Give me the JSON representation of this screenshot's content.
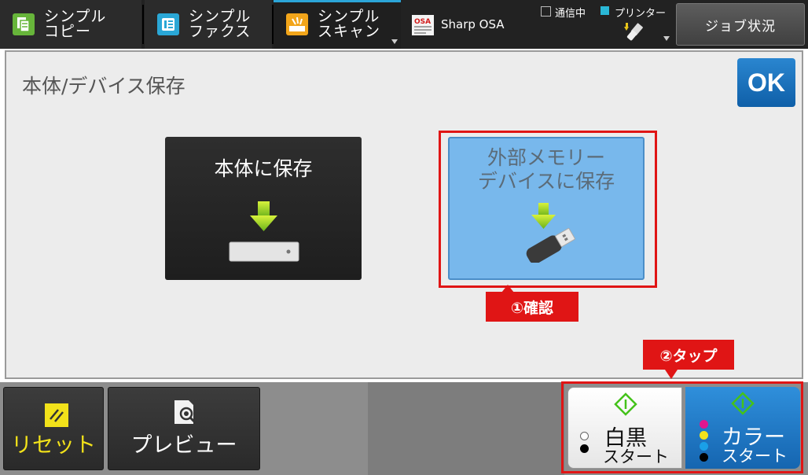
{
  "tabs": [
    {
      "label": "シンプル\nコピー",
      "active": false
    },
    {
      "label": "シンプル\nファクス",
      "active": false
    },
    {
      "label": "シンプル\nスキャン",
      "active": true
    }
  ],
  "osa": {
    "label": "Sharp OSA"
  },
  "status": {
    "comm_label": "通信中",
    "printer_label": "プリンター"
  },
  "job_status": {
    "label": "ジョブ状況"
  },
  "main": {
    "title": "本体/デバイス保存",
    "ok_label": "OK",
    "save_body_label": "本体に保存",
    "save_external_label": "外部メモリー\nデバイスに保存"
  },
  "callouts": {
    "step1": "①確認",
    "step2": "②タップ"
  },
  "bottom": {
    "reset_label": "リセット",
    "preview_label": "プレビュー",
    "bw_main": "白黒",
    "bw_sub": "スタート",
    "color_main": "カラー",
    "color_sub": "スタート"
  },
  "colors": {
    "accent": "#2ba5d8",
    "ok": "#1a6fbd",
    "callout": "#e01515",
    "selected_card": "#78b8ec",
    "reset_text": "#f2e21a",
    "start_green": "#44c21a"
  },
  "icons": {
    "copy": "copy-icon",
    "fax": "fax-icon",
    "scan": "scan-icon",
    "osa": "osa-icon",
    "usb": "usb-icon",
    "reset": "reset-icon",
    "preview": "preview-icon",
    "start": "start-icon"
  }
}
